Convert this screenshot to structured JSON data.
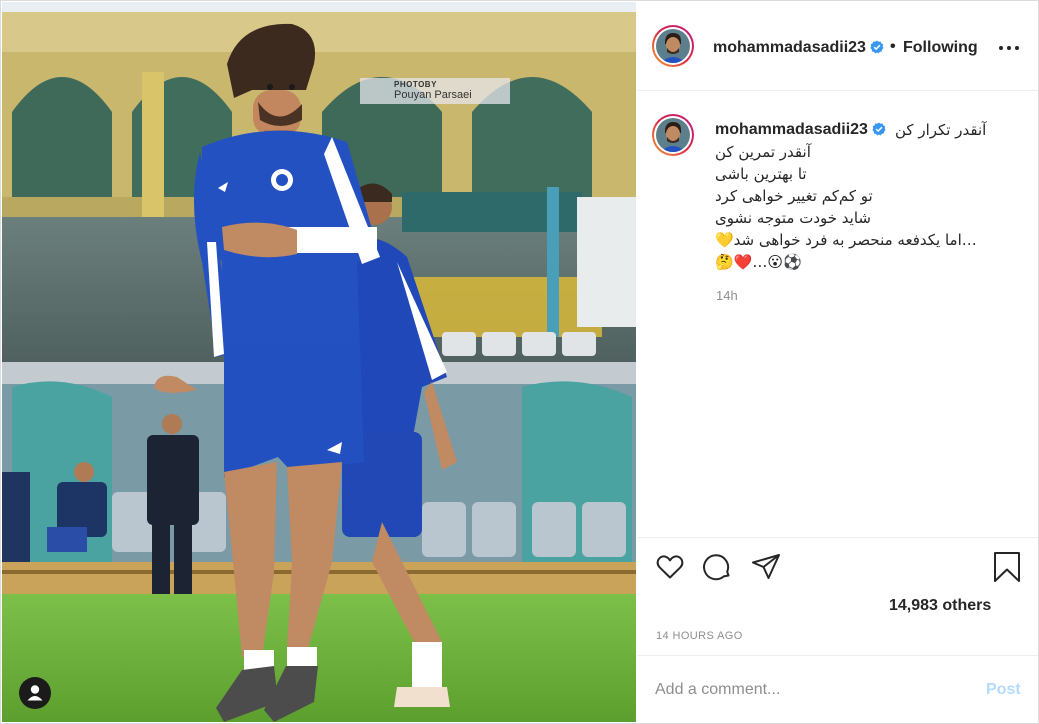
{
  "photo": {
    "watermark_top": "PHOTOBY",
    "watermark_bottom": "Pouyan Parsaei"
  },
  "header": {
    "username": "mohammadasadii23",
    "separator": "•",
    "follow_status": "Following",
    "verified_icon": "verified-badge-icon",
    "more_icon": "more-options-icon"
  },
  "caption": {
    "username": "mohammadasadii23",
    "lines": [
      "آنقدر تکرار کن",
      "آنقدر تمرین کن",
      "تا بهترین باشی",
      "تو کم‌کم تغییر خواهی کرد",
      "شاید خودت متوجه نشوی",
      "…اما یکدفعه منحصر به فرد خواهی شد💛",
      "⚽️😮…❤️🤔"
    ],
    "age": "14h"
  },
  "actions": {
    "like_icon": "heart-icon",
    "comment_icon": "comment-icon",
    "share_icon": "share-icon",
    "save_icon": "bookmark-icon",
    "likes_text": "14,983 others",
    "posted_time": "14 HOURS AGO"
  },
  "comment": {
    "placeholder": "Add a comment...",
    "post_label": "Post"
  },
  "colors": {
    "verified_blue": "#3897f0",
    "post_disabled": "#b3dbff",
    "text_primary": "#262626",
    "text_secondary": "#8e8e8e"
  }
}
